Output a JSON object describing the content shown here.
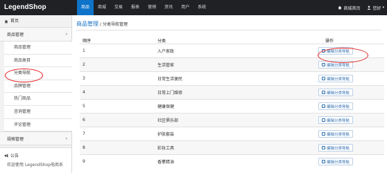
{
  "topbar": {
    "logo": "LegendShop",
    "nav": [
      "商品",
      "商城",
      "交易",
      "报表",
      "营销",
      "资讯",
      "用户",
      "系统"
    ],
    "home_link": "商城首页",
    "user_label": "您好"
  },
  "sidebar": {
    "home": "首页",
    "section1": "商品管理",
    "items": [
      "商品管理",
      "商品类目",
      "分类导航",
      "品牌管理",
      "热门商品",
      "咨询管理",
      "评论管理"
    ],
    "section2": "规格管理",
    "notice_title": "公告",
    "notice_text": "欢迎使用 LegendShop电商系"
  },
  "main": {
    "breadcrumb_main": "商品管理",
    "breadcrumb_sep": "/",
    "breadcrumb_current": "分类导航管理",
    "headers": {
      "index": "顺序",
      "category": "分类",
      "action": "操作"
    },
    "rows": [
      {
        "index": "1",
        "category": "入户家政",
        "action": "编辑分类导航"
      },
      {
        "index": "2",
        "category": "生活管家",
        "action": "编辑分类导航"
      },
      {
        "index": "3",
        "category": "日常生活便民",
        "action": "编辑分类导航"
      },
      {
        "index": "4",
        "category": "日常上门维修",
        "action": "编辑分类导航"
      },
      {
        "index": "5",
        "category": "健康保健",
        "action": "编辑分类导航"
      },
      {
        "index": "6",
        "category": "社区俱乐部",
        "action": "编辑分类导航"
      },
      {
        "index": "7",
        "category": "护肤套装",
        "action": "编辑分类导航"
      },
      {
        "index": "8",
        "category": "彩妆工具",
        "action": "编辑分类导航"
      },
      {
        "index": "9",
        "category": "香薰精油",
        "action": "编辑分类导航"
      }
    ]
  },
  "colors": {
    "topbar": "#1f2124",
    "accent": "#0e73c9",
    "annotation": "#e31b1b"
  }
}
